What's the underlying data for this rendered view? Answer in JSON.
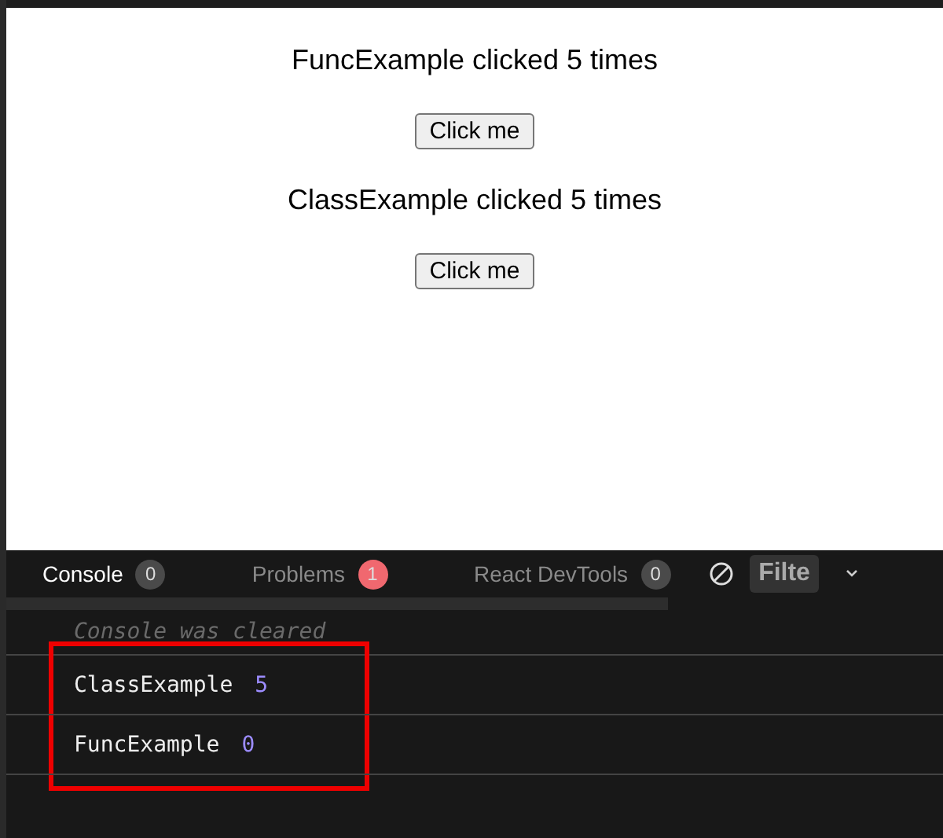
{
  "preview": {
    "sections": [
      {
        "heading": "FuncExample clicked 5 times",
        "button": "Click me"
      },
      {
        "heading": "ClassExample clicked 5 times",
        "button": "Click me"
      }
    ]
  },
  "devtools": {
    "tabs": [
      {
        "label": "Console",
        "count": "0",
        "selected": true,
        "color": "#4a4a4a"
      },
      {
        "label": "Problems",
        "count": "1",
        "selected": false,
        "color": "#f0686f"
      },
      {
        "label": "React DevTools",
        "count": "0",
        "selected": false,
        "color": "#4a4a4a"
      }
    ],
    "filter": {
      "placeholder": "Filte"
    },
    "console": [
      {
        "kind": "info",
        "text": "Console was cleared"
      },
      {
        "kind": "log",
        "text": "ClassExample",
        "value": "5"
      },
      {
        "kind": "log",
        "text": "FuncExample",
        "value": "0"
      }
    ]
  }
}
